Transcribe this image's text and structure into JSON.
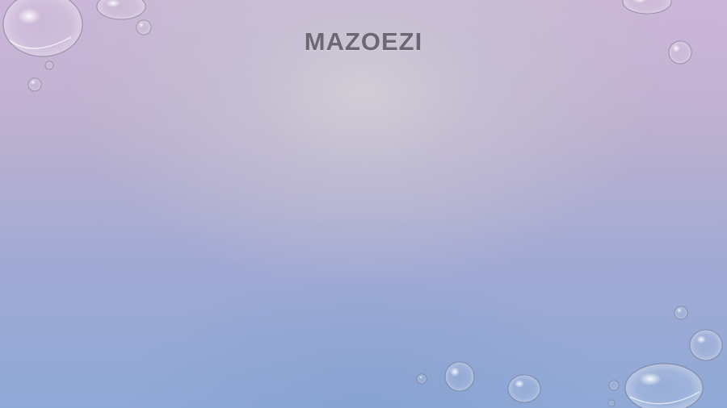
{
  "slide": {
    "title": "MAZOEZI"
  },
  "colors": {
    "title": "#6b6872",
    "background_top": "#c9b8d3",
    "background_bottom": "#8fa9d6",
    "glow_center": "#d2ced6"
  }
}
